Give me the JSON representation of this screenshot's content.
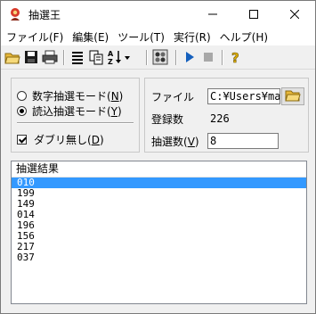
{
  "window": {
    "title": "抽選王"
  },
  "menu": [
    {
      "label": "ファイル(F)"
    },
    {
      "label": "編集(E)"
    },
    {
      "label": "ツール(T)"
    },
    {
      "label": "実行(R)"
    },
    {
      "label": "ヘルプ(H)"
    }
  ],
  "toolbar_icons": [
    "open-folder-icon",
    "save-icon",
    "print-icon",
    "list-icon",
    "copy-icon",
    "sort-icon",
    "dropdown-arrow-icon",
    "lottery-icon",
    "play-icon",
    "stop-icon",
    "help-icon"
  ],
  "mode": {
    "option1": {
      "label": "数字抽選モード(",
      "key": "N",
      "suffix": ")",
      "selected": false
    },
    "option2": {
      "label": "読込抽選モード(",
      "key": "Y",
      "suffix": ")",
      "selected": true
    },
    "nodup": {
      "label": "ダブリ無し(",
      "key": "D",
      "suffix": ")",
      "checked": true
    }
  },
  "info": {
    "file_label": "ファイル",
    "file_value": "C:¥Users¥ma",
    "count_label": "登録数",
    "count_value": "226",
    "draw_label": "抽選数(",
    "draw_key": "V",
    "draw_suffix": ")",
    "draw_value": "8"
  },
  "results": {
    "header": "抽選結果",
    "rows": [
      "010",
      "199",
      "149",
      "014",
      "196",
      "156",
      "217",
      "037"
    ]
  },
  "colors": {
    "selection": "#3399ff",
    "app_icon": "#d83a2a"
  }
}
